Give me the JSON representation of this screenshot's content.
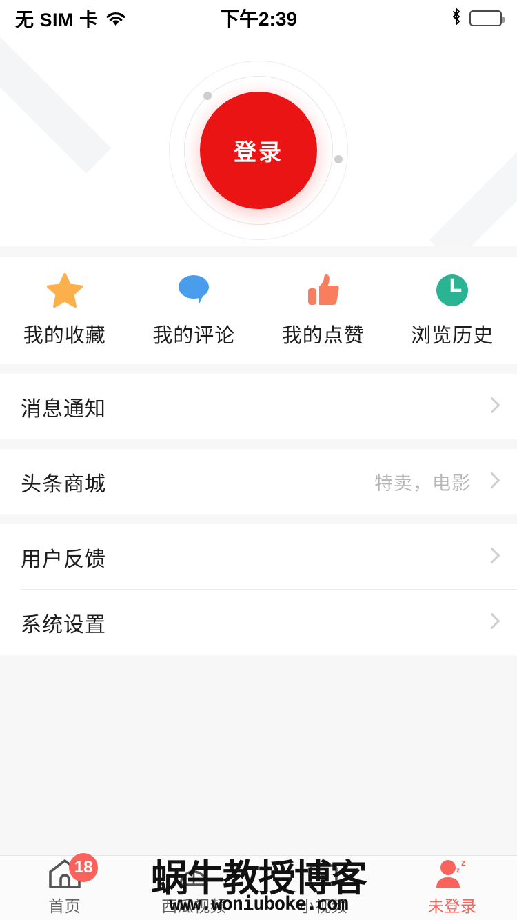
{
  "status_bar": {
    "carrier": "无 SIM 卡",
    "wifi_icon": "wifi-icon",
    "time": "下午2:39",
    "bluetooth_icon": "bluetooth-icon",
    "battery_icon": "battery-icon"
  },
  "header": {
    "login_label": "登录",
    "login_color": "#ea1414"
  },
  "quick_actions": [
    {
      "label": "我的收藏",
      "icon": "star-icon",
      "color": "#fbb04c"
    },
    {
      "label": "我的评论",
      "icon": "speech-bubble-icon",
      "color": "#4a9ded"
    },
    {
      "label": "我的点赞",
      "icon": "thumbs-up-icon",
      "color": "#f97e5d"
    },
    {
      "label": "浏览历史",
      "icon": "clock-icon",
      "color": "#2bb494"
    }
  ],
  "menu_groups": [
    {
      "rows": [
        {
          "title": "消息通知",
          "value": "",
          "arrow": "chevron-right-icon"
        }
      ]
    },
    {
      "rows": [
        {
          "title": "头条商城",
          "value": "特卖，电影",
          "arrow": "chevron-right-icon"
        }
      ]
    },
    {
      "rows": [
        {
          "title": "用户反馈",
          "value": "",
          "arrow": "chevron-right-icon"
        },
        {
          "title": "系统设置",
          "value": "",
          "arrow": "chevron-right-icon"
        }
      ]
    }
  ],
  "tab_bar": {
    "active_color": "#f9635c",
    "tabs": [
      {
        "label": "首页",
        "icon": "home-icon",
        "badge": "18",
        "active": false
      },
      {
        "label": "西瓜视频",
        "icon": "watermelon-video-icon",
        "badge": "",
        "active": false
      },
      {
        "label": "小视频",
        "icon": "short-video-icon",
        "badge": "",
        "active": false
      },
      {
        "label": "未登录",
        "icon": "sleeping-user-icon",
        "badge": "",
        "active": true
      }
    ]
  },
  "watermark": {
    "title": "蜗牛教授博客",
    "url": "www.woniuboke.com"
  }
}
